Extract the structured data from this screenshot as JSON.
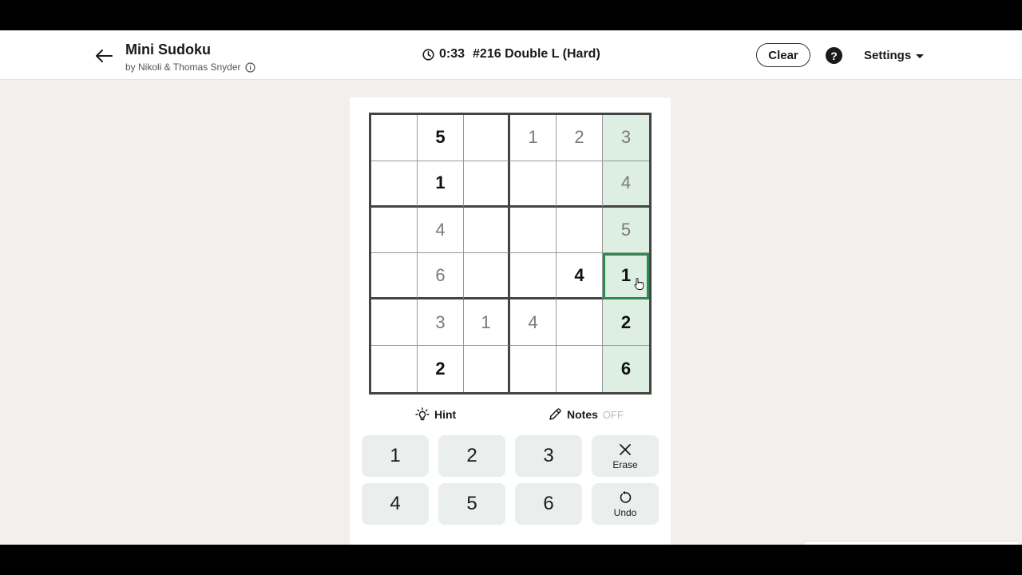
{
  "header": {
    "title": "Mini Sudoku",
    "byline": "by Nikoli & Thomas Snyder",
    "timer": "0:33",
    "puzzle_label": "#216 Double L (Hard)",
    "clear_label": "Clear",
    "help_label": "?",
    "settings_label": "Settings"
  },
  "board": {
    "rows": [
      [
        {
          "v": "",
          "t": "empty"
        },
        {
          "v": "5",
          "t": "given"
        },
        {
          "v": "",
          "t": "empty"
        },
        {
          "v": "1",
          "t": "entered"
        },
        {
          "v": "2",
          "t": "entered"
        },
        {
          "v": "3",
          "t": "entered"
        }
      ],
      [
        {
          "v": "",
          "t": "empty"
        },
        {
          "v": "1",
          "t": "given"
        },
        {
          "v": "",
          "t": "empty"
        },
        {
          "v": "",
          "t": "empty"
        },
        {
          "v": "",
          "t": "empty"
        },
        {
          "v": "4",
          "t": "entered"
        }
      ],
      [
        {
          "v": "",
          "t": "empty"
        },
        {
          "v": "4",
          "t": "entered"
        },
        {
          "v": "",
          "t": "empty"
        },
        {
          "v": "",
          "t": "empty"
        },
        {
          "v": "",
          "t": "empty"
        },
        {
          "v": "5",
          "t": "entered"
        }
      ],
      [
        {
          "v": "",
          "t": "empty"
        },
        {
          "v": "6",
          "t": "entered"
        },
        {
          "v": "",
          "t": "empty"
        },
        {
          "v": "",
          "t": "empty"
        },
        {
          "v": "4",
          "t": "given"
        },
        {
          "v": "1",
          "t": "given"
        }
      ],
      [
        {
          "v": "",
          "t": "empty"
        },
        {
          "v": "3",
          "t": "entered"
        },
        {
          "v": "1",
          "t": "entered"
        },
        {
          "v": "4",
          "t": "entered"
        },
        {
          "v": "",
          "t": "empty"
        },
        {
          "v": "2",
          "t": "given"
        }
      ],
      [
        {
          "v": "",
          "t": "empty"
        },
        {
          "v": "2",
          "t": "given"
        },
        {
          "v": "",
          "t": "empty"
        },
        {
          "v": "",
          "t": "empty"
        },
        {
          "v": "",
          "t": "empty"
        },
        {
          "v": "6",
          "t": "given"
        }
      ]
    ],
    "selected": {
      "row": 3,
      "col": 5
    },
    "highlight_color": "#dcefe2",
    "selected_border_color": "#2e8a4f"
  },
  "tools": {
    "hint_label": "Hint",
    "notes_label": "Notes",
    "notes_state": "OFF"
  },
  "keypad": {
    "digits": [
      "1",
      "2",
      "3",
      "4",
      "5",
      "6"
    ],
    "erase_label": "Erase",
    "undo_label": "Undo"
  }
}
